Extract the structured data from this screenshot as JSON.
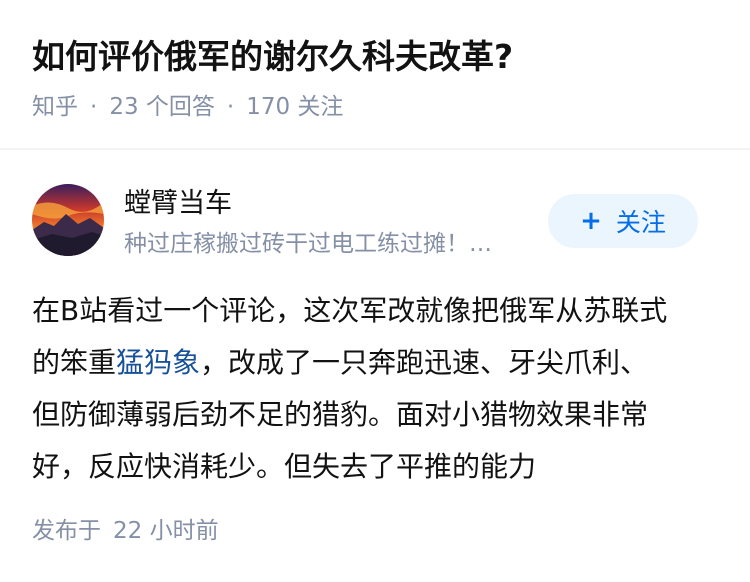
{
  "question": {
    "title": "如何评价俄军的谢尔久科夫改革?",
    "source": "知乎",
    "answer_count": "23 个回答",
    "follower_count": "170 关注"
  },
  "author": {
    "name": "螳臂当车",
    "bio": "种过庄稼搬过砖干过电工练过摊！…",
    "follow_label": "关注",
    "follow_icon": "plus-icon"
  },
  "answer": {
    "line1": "在B站看过一个评论，这次军改就像把俄军从苏联式",
    "line2_before": "的笨重",
    "line2_link": "猛犸象",
    "line2_after": "，改成了一只奔跑迅速、牙尖爪利、",
    "line3": "但防御薄弱后劲不足的猎豹。面对小猎物效果非常",
    "line4": "好，反应快消耗少。但失去了平推的能力"
  },
  "footer": {
    "published_label": "发布于",
    "published_time": "22 小时前"
  },
  "colors": {
    "accent": "#056de8",
    "link": "#175199",
    "meta": "#8590a6",
    "follow_bg": "#ebf5fd"
  }
}
